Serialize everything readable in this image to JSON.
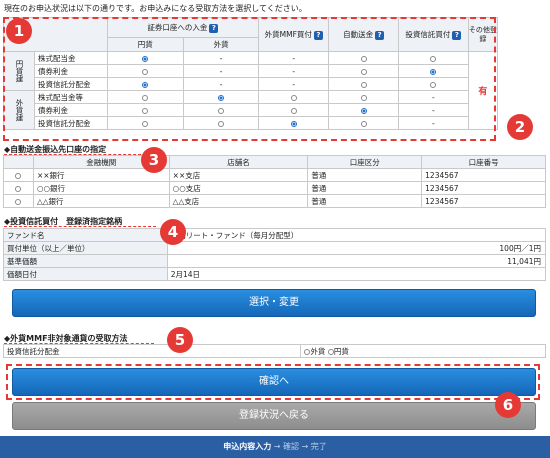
{
  "intro": "現在のお申込状況は以下の通りです。お申込みになる受取方法を選択してください。",
  "receipt": {
    "head_securities": "証券口座への入金",
    "head_jpy": "円貨",
    "head_fx": "外貨",
    "head_mmf": "外貨MMF買付",
    "head_auto": "自動送金",
    "head_fund": "投資信託買付",
    "head_other": "その他登録",
    "group_jpy": "円貨建",
    "group_fx": "外貨建",
    "dash": "-",
    "other_value": "有",
    "rows": [
      {
        "label": "株式配当金"
      },
      {
        "label": "債券利金"
      },
      {
        "label": "投資信託分配金"
      },
      {
        "label": "株式配当金等"
      },
      {
        "label": "債券利金"
      },
      {
        "label": "投資信託分配金"
      }
    ]
  },
  "auto_transfer": {
    "title": "◆自動送金振込先口座の指定",
    "headers": [
      "金融機関",
      "店舗名",
      "口座区分",
      "口座番号"
    ],
    "rows": [
      {
        "bank": "××銀行",
        "branch": "××支店",
        "type": "普通",
        "number": "1234567"
      },
      {
        "bank": "○○銀行",
        "branch": "○○支店",
        "type": "普通",
        "number": "1234567"
      },
      {
        "bank": "△△銀行",
        "branch": "△△支店",
        "type": "普通",
        "number": "1234567"
      }
    ]
  },
  "fund": {
    "title": "◆投資信託買付　登録済指定銘柄",
    "rows": [
      {
        "label": "ファンド名",
        "value": "米国リート・ファンド（毎月分配型）"
      },
      {
        "label": "買付単位（以上／単位）",
        "value": "100円／1円"
      },
      {
        "label": "基準価額",
        "value": "11,041円"
      },
      {
        "label": "価額日付",
        "value": "2月14日"
      }
    ],
    "select_button": "選択・変更"
  },
  "mmf": {
    "title": "◆外貨MMF非対象通貨の受取方法",
    "label": "投資信託分配金",
    "opt_fx": "外貨",
    "opt_jpy": "円貨"
  },
  "confirm_button": "確認へ",
  "back_button": "登録状況へ戻る",
  "footer": {
    "current": "申込内容入力",
    "arrow1": " → ",
    "step2": "確認",
    "arrow2": " → ",
    "step3": "完了"
  },
  "badges": [
    "1",
    "2",
    "3",
    "4",
    "5",
    "6"
  ]
}
